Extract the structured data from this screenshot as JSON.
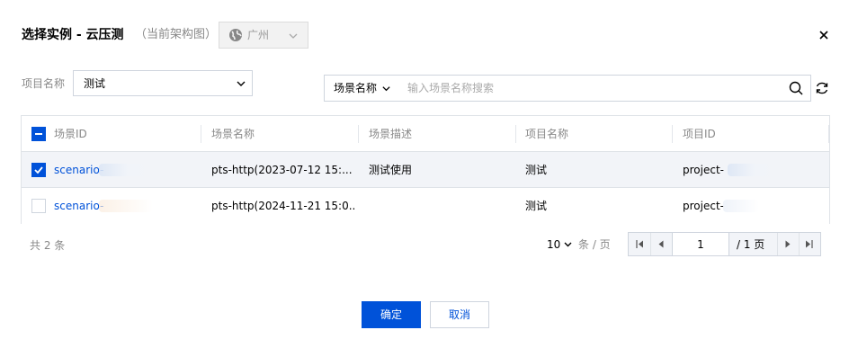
{
  "dialog": {
    "title": "选择实例 - 云压测",
    "arch_label": "（当前架构图）",
    "region": "广州",
    "close_icon": "close-icon"
  },
  "filters": {
    "project_label": "项目名称",
    "project_value": "测试",
    "search_scope": "场景名称",
    "search_placeholder": "输入场景名称搜索",
    "search_value": ""
  },
  "table": {
    "columns": [
      "场景ID",
      "场景名称",
      "场景描述",
      "项目名称",
      "项目ID"
    ],
    "rows": [
      {
        "checked": true,
        "scenario_id": "scenario-",
        "scenario_name": "pts-http(2023-07-12 15:...",
        "description": "测试使用",
        "project_name": "测试",
        "project_id": "project-"
      },
      {
        "checked": false,
        "scenario_id": "scenario-",
        "scenario_name": "pts-http(2024-11-21 15:0...",
        "description": "",
        "project_name": "测试",
        "project_id": "project-"
      }
    ]
  },
  "pagination": {
    "total": "共 2 条",
    "page_size": "10",
    "page_size_unit": "条 / 页",
    "current_page": "1",
    "total_pages": "/ 1 页"
  },
  "footer": {
    "ok_label": "确定",
    "cancel_label": "取消"
  },
  "colors": {
    "primary": "#0052d9",
    "selected_row": "#f2f4f8",
    "border": "#dfe3e8"
  }
}
